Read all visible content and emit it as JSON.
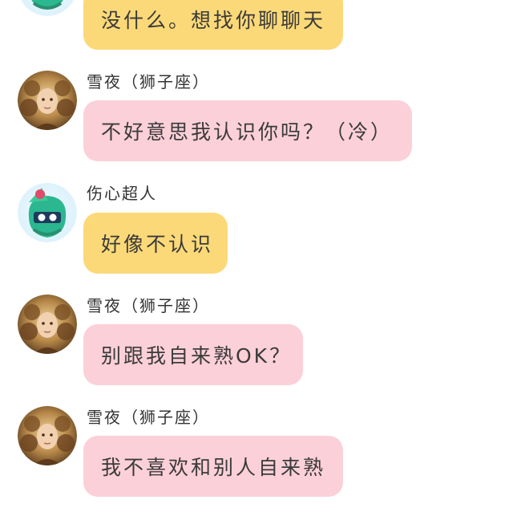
{
  "colors": {
    "yellow_bubble": "#fcd978",
    "pink_bubble": "#fcd0d9",
    "background": "#ffffff"
  },
  "messages": [
    {
      "sender": "",
      "avatar": "green-monster-avatar",
      "text": "没什么。想找你聊聊天",
      "style": "yellow"
    },
    {
      "sender": "雪夜（狮子座）",
      "avatar": "lion-girl-avatar",
      "text": "不好意思我认识你吗？（冷）",
      "style": "pink"
    },
    {
      "sender": "伤心超人",
      "avatar": "green-monster-avatar",
      "text": "好像不认识",
      "style": "yellow"
    },
    {
      "sender": "雪夜（狮子座）",
      "avatar": "lion-girl-avatar",
      "text": "别跟我自来熟OK？",
      "style": "pink"
    },
    {
      "sender": "雪夜（狮子座）",
      "avatar": "lion-girl-avatar",
      "text": "我不喜欢和别人自来熟",
      "style": "pink"
    }
  ]
}
